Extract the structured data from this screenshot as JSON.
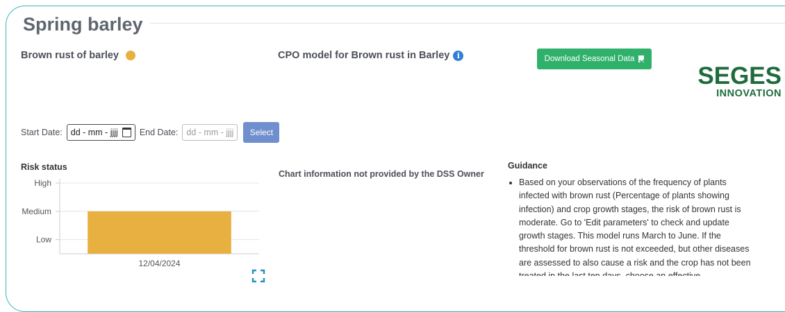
{
  "page": {
    "title": "Spring barley"
  },
  "disease": {
    "name": "Brown rust of barley",
    "status_color": "#e8b040"
  },
  "model": {
    "name": "CPO model for Brown rust in Barley",
    "info_icon": "info-icon",
    "info_color": "#2f7fd6"
  },
  "download": {
    "label": "Download Seasonal Data",
    "icon": "file-download-icon",
    "color": "#2fb06b"
  },
  "logo": {
    "main": "SEGES",
    "sub": "INNOVATION",
    "color": "#1e6b3c"
  },
  "dates": {
    "start_label": "Start Date:",
    "start_value": "dd - mm - jjjj",
    "end_label": "End Date:",
    "end_value": "dd - mm - jjjj",
    "select_label": "Select",
    "select_color": "#6f8fce"
  },
  "risk": {
    "heading": "Risk status"
  },
  "chart_data": {
    "type": "bar",
    "categories": [
      "12/04/2024"
    ],
    "values": [
      2
    ],
    "y_levels": [
      "Low",
      "Medium",
      "High"
    ],
    "ylim": [
      0.5,
      3
    ],
    "bar_color": "#e8b040",
    "grid": true
  },
  "chart_info": {
    "text": "Chart information not provided by the DSS Owner"
  },
  "guidance": {
    "heading": "Guidance",
    "text": "Based on your observations of the frequency of plants infected with brown rust (Percentage of plants showing infection) and crop growth stages, the risk of brown rust is moderate. Go to 'Edit parameters' to check and update growth stages. This model runs March to June. If the threshold for brown rust is not exceeded, but other diseases are assessed to also cause a risk and the crop has not been treated in the last ten days, choose an effective"
  },
  "expand": {
    "icon": "expand-icon",
    "color": "#2a8fc0"
  }
}
